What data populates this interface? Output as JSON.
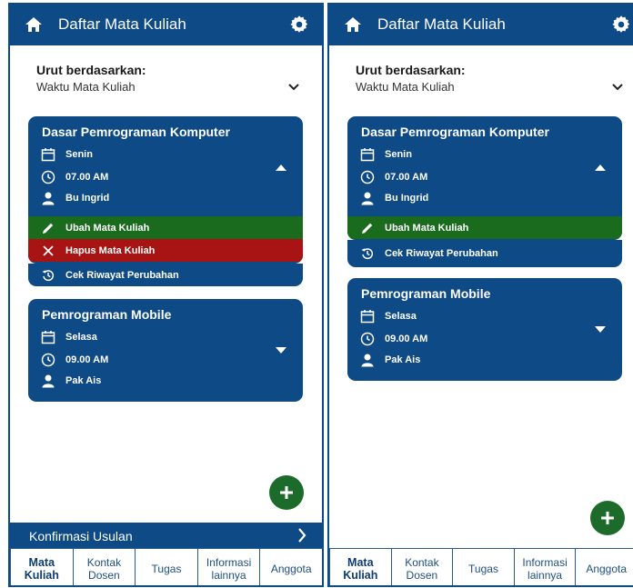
{
  "app": {
    "title": "Daftar Mata Kuliah",
    "colors": {
      "primary": "#0d4a86",
      "edit": "#1b6b1e",
      "delete": "#a81313",
      "fab": "#1d6b2a"
    }
  },
  "sort": {
    "label": "Urut berdasarkan:",
    "value": "Waktu Mata Kuliah"
  },
  "courses": [
    {
      "name": "Dasar Pemrograman Komputer",
      "day": "Senin",
      "time": "07.00 AM",
      "lecturer": "Bu Ingrid"
    },
    {
      "name": "Pemrograman Mobile",
      "day": "Selasa",
      "time": "09.00 AM",
      "lecturer": "Pak Ais"
    }
  ],
  "actions": {
    "edit": "Ubah Mata Kuliah",
    "delete": "Hapus Mata Kuliah",
    "history": "Cek Riwayat Perubahan"
  },
  "confirm_bar": {
    "label": "Konfirmasi Usulan"
  },
  "tabs": [
    {
      "line1": "Mata",
      "line2": "Kuliah"
    },
    {
      "line1": "Kontak",
      "line2": "Dosen"
    },
    {
      "line1": "Tugas",
      "line2": ""
    },
    {
      "line1": "Informasi",
      "line2": "lainnya"
    },
    {
      "line1": "Anggota",
      "line2": ""
    }
  ],
  "icons": [
    "home-icon",
    "gear-icon",
    "chevron-down-icon",
    "calendar-icon",
    "clock-icon",
    "person-icon",
    "caret-up-icon",
    "caret-down-icon",
    "pencil-icon",
    "close-icon",
    "history-icon",
    "plus-icon",
    "chevron-right-icon"
  ]
}
